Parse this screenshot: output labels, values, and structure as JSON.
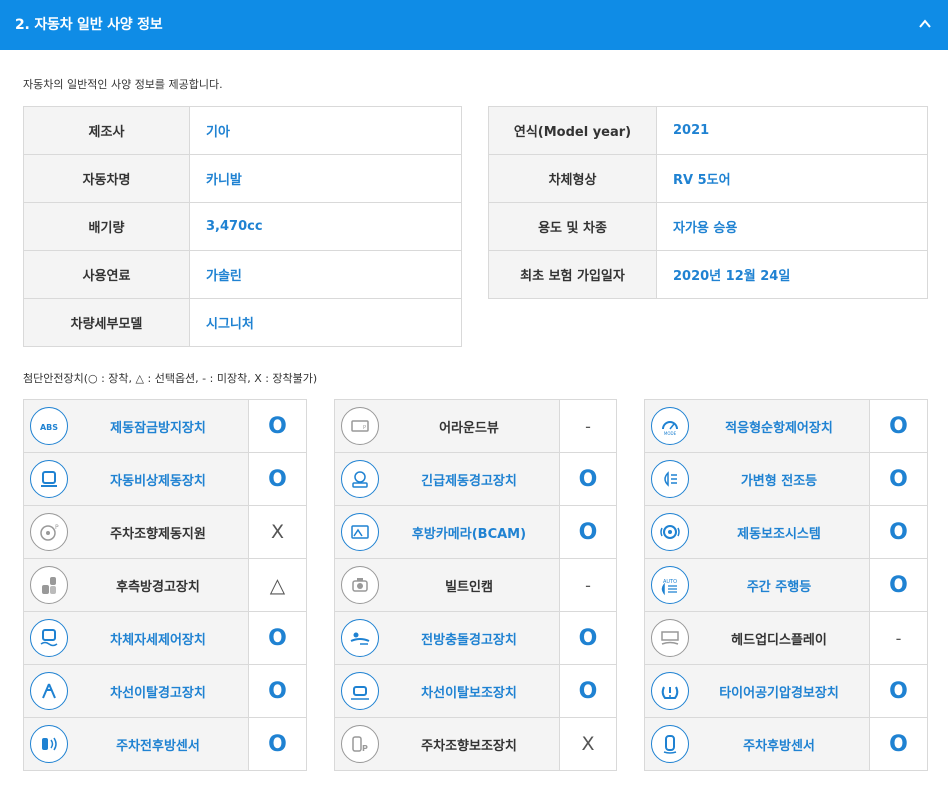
{
  "header": {
    "title": "2. 자동차 일반 사양 정보"
  },
  "intro": "자동차의 일반적인 사양 정보를 제공합니다.",
  "spec_left": [
    {
      "key": "제조사",
      "value": "기아"
    },
    {
      "key": "자동차명",
      "value": "카니발"
    },
    {
      "key": "배기량",
      "value": "3,470cc"
    },
    {
      "key": "사용연료",
      "value": "가솔린"
    },
    {
      "key": "차량세부모델",
      "value": "시그니처"
    }
  ],
  "spec_right": [
    {
      "key": "연식(Model year)",
      "value": "2021"
    },
    {
      "key": "차체형상",
      "value": "RV 5도어"
    },
    {
      "key": "용도 및 차종",
      "value": "자가용  승용"
    },
    {
      "key": "최초 보험 가입일자",
      "value": "2020년 12월 24일"
    }
  ],
  "legend": "첨단안전장치(○ : 장착, △ : 선택옵션, - : 미장착, X : 장착불가)",
  "safety_col1": [
    {
      "icon": "abs-icon",
      "label": "제동잠금방지장치",
      "status": "O"
    },
    {
      "icon": "emergency-brake-icon",
      "label": "자동비상제동장치",
      "status": "O"
    },
    {
      "icon": "parking-steering-icon",
      "label": "주차조향제동지원",
      "status": "X"
    },
    {
      "icon": "rear-warning-icon",
      "label": "후측방경고장치",
      "status": "△"
    },
    {
      "icon": "stability-control-icon",
      "label": "차체자세제어장치",
      "status": "O"
    },
    {
      "icon": "lane-departure-warning-icon",
      "label": "차선이탈경고장치",
      "status": "O"
    },
    {
      "icon": "parking-sensor-icon",
      "label": "주차전후방센서",
      "status": "O"
    }
  ],
  "safety_col2": [
    {
      "icon": "around-view-icon",
      "label": "어라운드뷰",
      "status": "-"
    },
    {
      "icon": "emergency-brake-warning-icon",
      "label": "긴급제동경고장치",
      "status": "O"
    },
    {
      "icon": "rear-camera-icon",
      "label": "후방카메라(BCAM)",
      "status": "O"
    },
    {
      "icon": "built-in-cam-icon",
      "label": "빌트인캠",
      "status": "-"
    },
    {
      "icon": "forward-collision-icon",
      "label": "전방충돌경고장치",
      "status": "O"
    },
    {
      "icon": "lane-keeping-assist-icon",
      "label": "차선이탈보조장치",
      "status": "O"
    },
    {
      "icon": "parking-assist-icon",
      "label": "주차조향보조장치",
      "status": "X"
    }
  ],
  "safety_col3": [
    {
      "icon": "adaptive-cruise-icon",
      "label": "적응형순항제어장치",
      "status": "O"
    },
    {
      "icon": "adaptive-headlight-icon",
      "label": "가변형 전조등",
      "status": "O"
    },
    {
      "icon": "brake-assist-icon",
      "label": "제동보조시스템",
      "status": "O"
    },
    {
      "icon": "daytime-running-light-icon",
      "label": "주간 주행등",
      "status": "O"
    },
    {
      "icon": "head-up-display-icon",
      "label": "헤드업디스플레이",
      "status": "-"
    },
    {
      "icon": "tire-pressure-icon",
      "label": "타이어공기압경보장치",
      "status": "O"
    },
    {
      "icon": "rear-sensor-icon",
      "label": "주차후방센서",
      "status": "O"
    }
  ],
  "colors": {
    "header": "#0f8ce6",
    "accent": "#1f82d2",
    "cell_bg": "#f4f4f4",
    "border": "#d9d9d9"
  }
}
